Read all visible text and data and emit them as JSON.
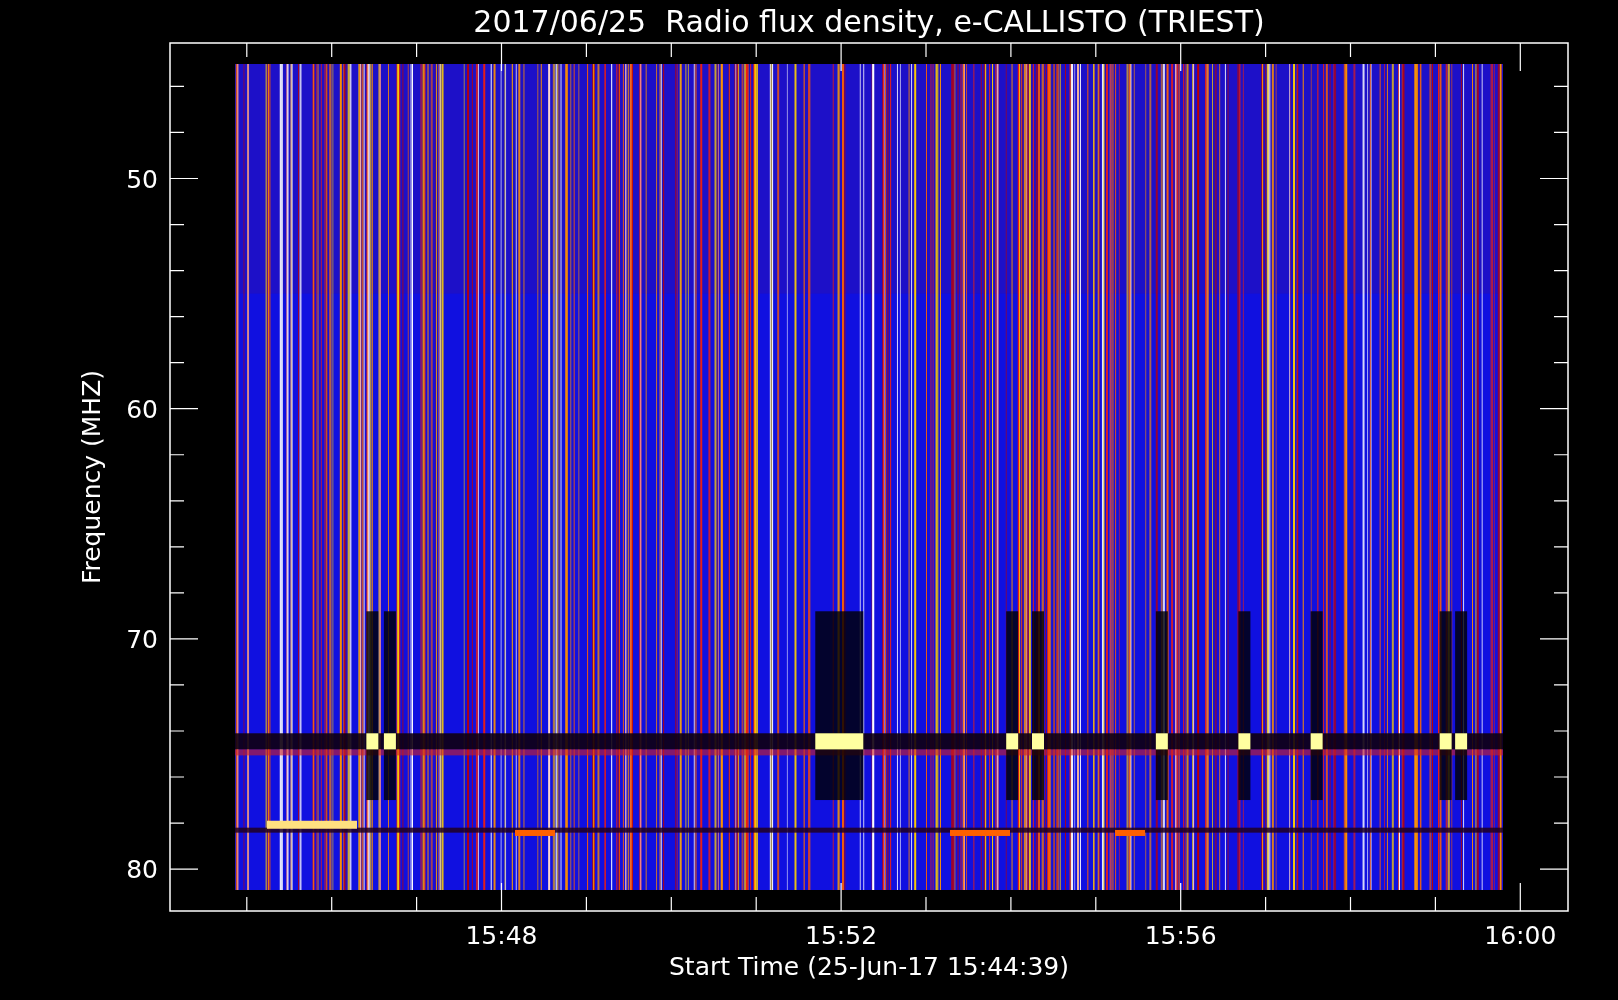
{
  "title": "2017/06/25  Radio flux density, e-CALLISTO (TRIEST)",
  "plot": {
    "ylabel": "Frequency (MHZ)",
    "xlabel": "Start Time (25-Jun-17 15:44:39)",
    "yticks": [
      "50",
      "60",
      "70",
      "80"
    ],
    "xticks": [
      "15:48",
      "15:52",
      "15:56",
      "16:00"
    ]
  }
}
